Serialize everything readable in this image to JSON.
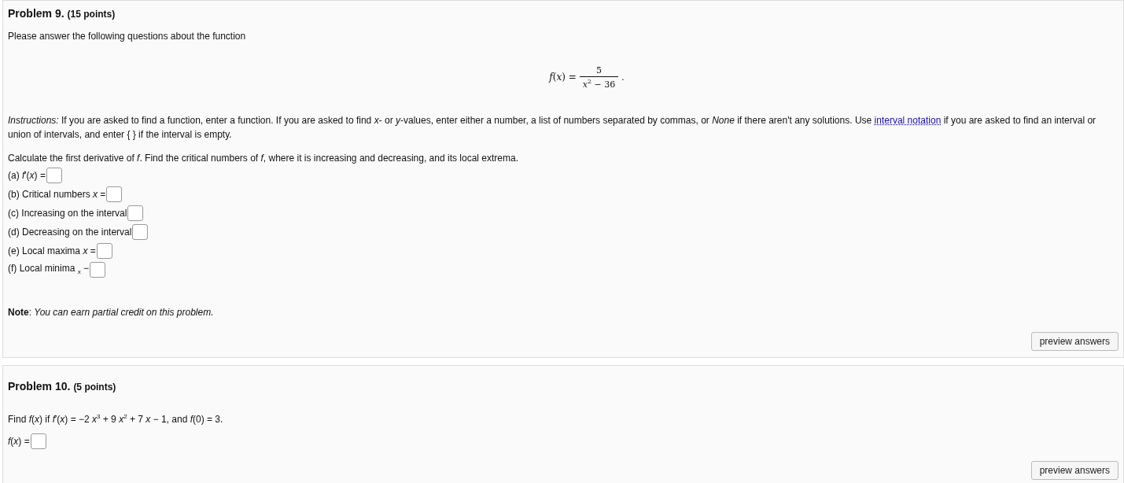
{
  "problems": [
    {
      "title": "Problem 9.",
      "points": "(15 points)",
      "intro": "Please answer the following questions about the function",
      "formula": {
        "lhs": "*f*(*x*) =",
        "numerator": "5",
        "denominator": "*x*$^{2}$ − 36",
        "end": "."
      },
      "instructions": {
        "before": "*Instructions:* If you are asked to find a function, enter a function. If you are asked to find *x*- or *y*-values, enter either a number, a list of numbers separated by commas, or *None* if there aren't any solutions. Use",
        "link": "interval notation",
        "after": "if you are asked to find an interval or union of intervals, and enter { } if the interval is empty."
      },
      "question": "Calculate the first derivative of *f*. Find the critical numbers of *f*, where it is increasing and decreasing, and its local extrema.",
      "parts": [
        {
          "label": "(a) *f*′(*x*) ="
        },
        {
          "label": "(b) Critical numbers *x* ="
        },
        {
          "label": "(c) Increasing on the interval"
        },
        {
          "label": "(d) Decreasing on the interval"
        },
        {
          "label": "(e) Local maxima *x* ="
        },
        {
          "label": "(f) Local minima $_{x}$ −"
        }
      ],
      "note": "**Note**: *You can earn partial credit on this problem.*",
      "button": "preview answers"
    },
    {
      "title": "Problem 10.",
      "points": "(5 points)",
      "question": "Find *f*(*x*) if *f*′(*x*) = −2 *x*$^{3}$ + 9 *x*$^{2}$ + 7 *x* − 1, and *f*(0) = 3.",
      "parts": [
        {
          "label": "*f*(*x*) ="
        }
      ],
      "button": "preview answers"
    }
  ]
}
